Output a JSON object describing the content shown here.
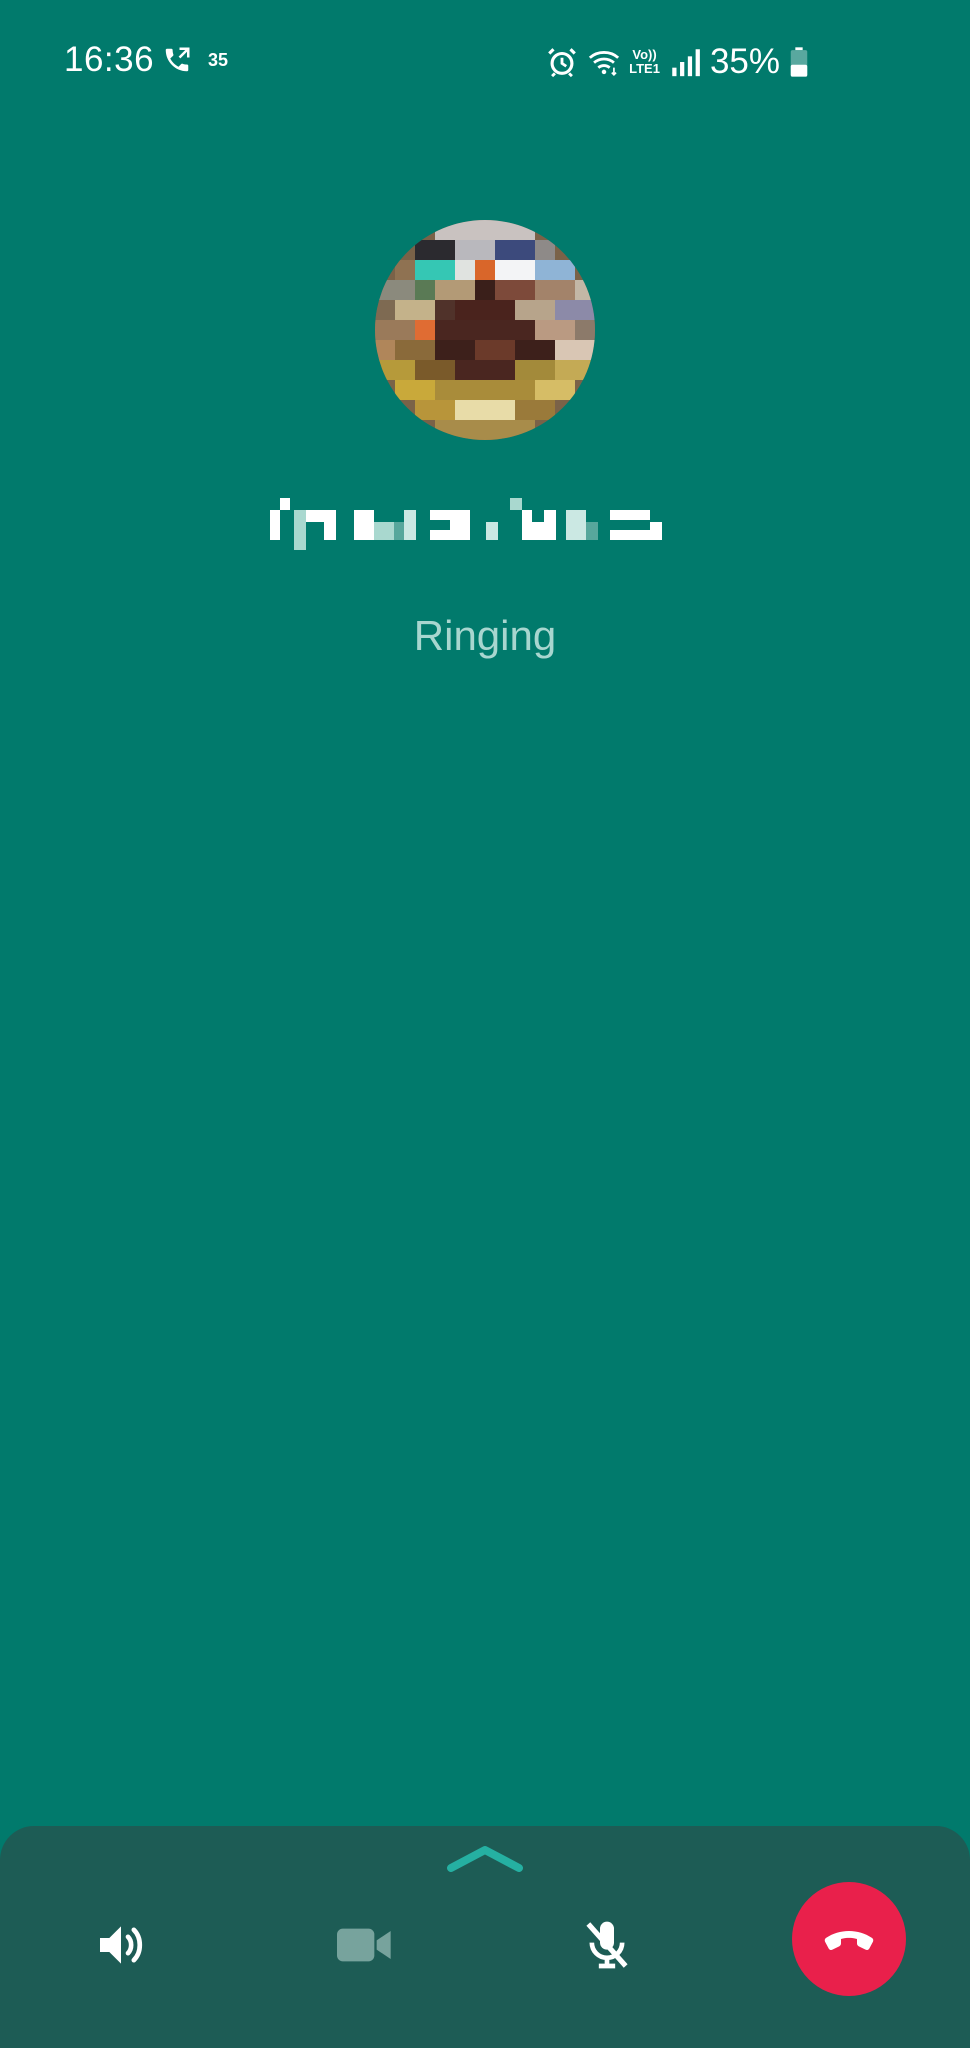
{
  "status_bar": {
    "time": "16:36",
    "call_indicator_icon": "outgoing-call-icon",
    "notification_badge": "35",
    "icons": [
      "alarm-icon",
      "wifi-icon",
      "volte-icon",
      "signal-icon",
      "battery-icon"
    ],
    "volte_top": "Vo))",
    "volte_bottom": "LTE1",
    "battery_percent": "35%"
  },
  "call": {
    "contact_name_redacted": true,
    "status": "Ringing"
  },
  "controls": {
    "expand_icon": "chevron-up-icon",
    "speaker_icon": "speaker-icon",
    "video_icon": "video-camera-icon",
    "mute_icon": "mic-off-icon",
    "end_call_icon": "end-call-icon"
  },
  "colors": {
    "background": "#017a6c",
    "panel": "#1d5c55",
    "end_call": "#e9204b",
    "status_text": "#a8d6cf",
    "accent": "#25b0a2"
  }
}
